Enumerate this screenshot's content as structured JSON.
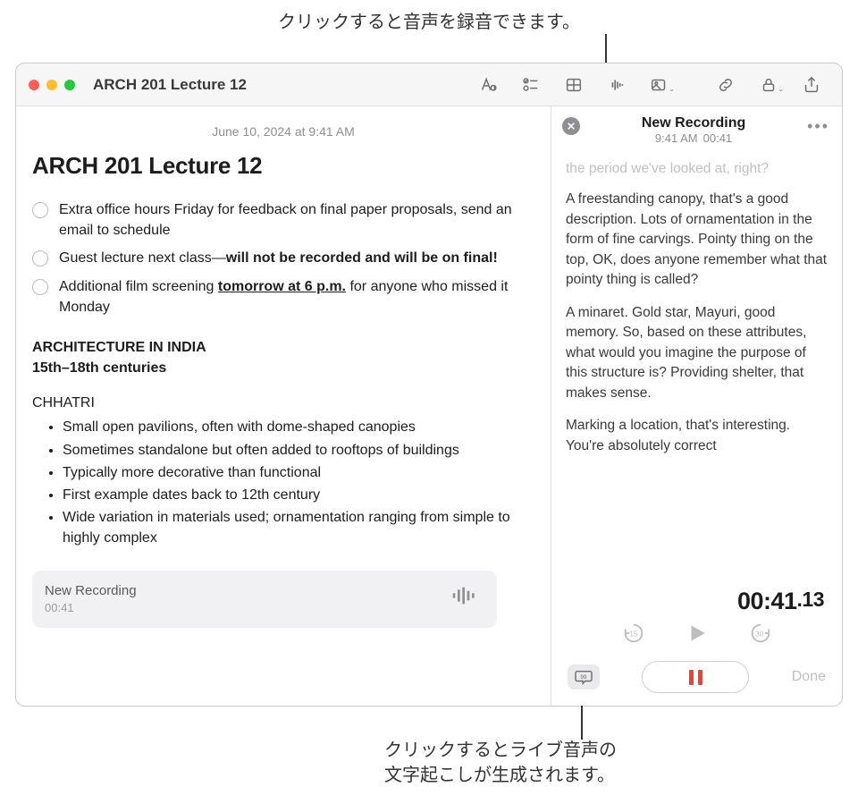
{
  "callouts": {
    "top": "クリックすると音声を録音できます。",
    "bottom_line1": "クリックするとライブ音声の",
    "bottom_line2": "文字起こしが生成されます。"
  },
  "window": {
    "title": "ARCH 201 Lecture 12"
  },
  "toolbar": {
    "format": "Format",
    "checklist": "Checklist",
    "table": "Table",
    "audio": "Record Audio",
    "media": "Media",
    "link": "Link Note",
    "lock": "Lock",
    "share": "Share"
  },
  "note": {
    "date": "June 10, 2024 at 9:41 AM",
    "title": "ARCH 201 Lecture 12",
    "checks": [
      {
        "pre": "Extra office hours Friday for feedback on final paper proposals, send an email to schedule",
        "bold": "",
        "post": ""
      },
      {
        "pre": "Guest lecture next class—",
        "bold": "will not be recorded and will be on final!",
        "post": ""
      },
      {
        "pre": "Additional film screening ",
        "bold": "tomorrow at 6 p.m.",
        "post": " for anyone who missed it Monday",
        "boldUnderline": true
      }
    ],
    "section1": "ARCHITECTURE IN INDIA",
    "section1_sub": "15th–18th centuries",
    "topic": "CHHATRI",
    "bullets": [
      "Small open pavilions, often with dome-shaped canopies",
      "Sometimes standalone but often added to rooftops of buildings",
      "Typically more decorative than functional",
      "First example dates back to 12th century",
      "Wide variation in materials used; ornamentation ranging from simple to highly complex"
    ],
    "rec_card": {
      "title": "New Recording",
      "time": "00:41"
    }
  },
  "recording": {
    "title": "New Recording",
    "time": "9:41 AM",
    "duration": "00:41",
    "transcript_faded": "the period we've looked at, right?",
    "transcript_p1": "A freestanding canopy, that's a good description. Lots of ornamentation in the form of fine carvings. Pointy thing on the top, OK, does anyone remember what that pointy thing is called?",
    "transcript_p2": "A minaret. Gold star, Mayuri, good memory. So, based on these attributes, what would you imagine the purpose of this structure is? Providing shelter, that makes sense.",
    "transcript_p3": "Marking a location, that's interesting. You're absolutely correct",
    "timer_main": "00:41",
    "timer_ms": ".13",
    "skip_back": "15",
    "skip_fwd": "30",
    "done": "Done"
  }
}
